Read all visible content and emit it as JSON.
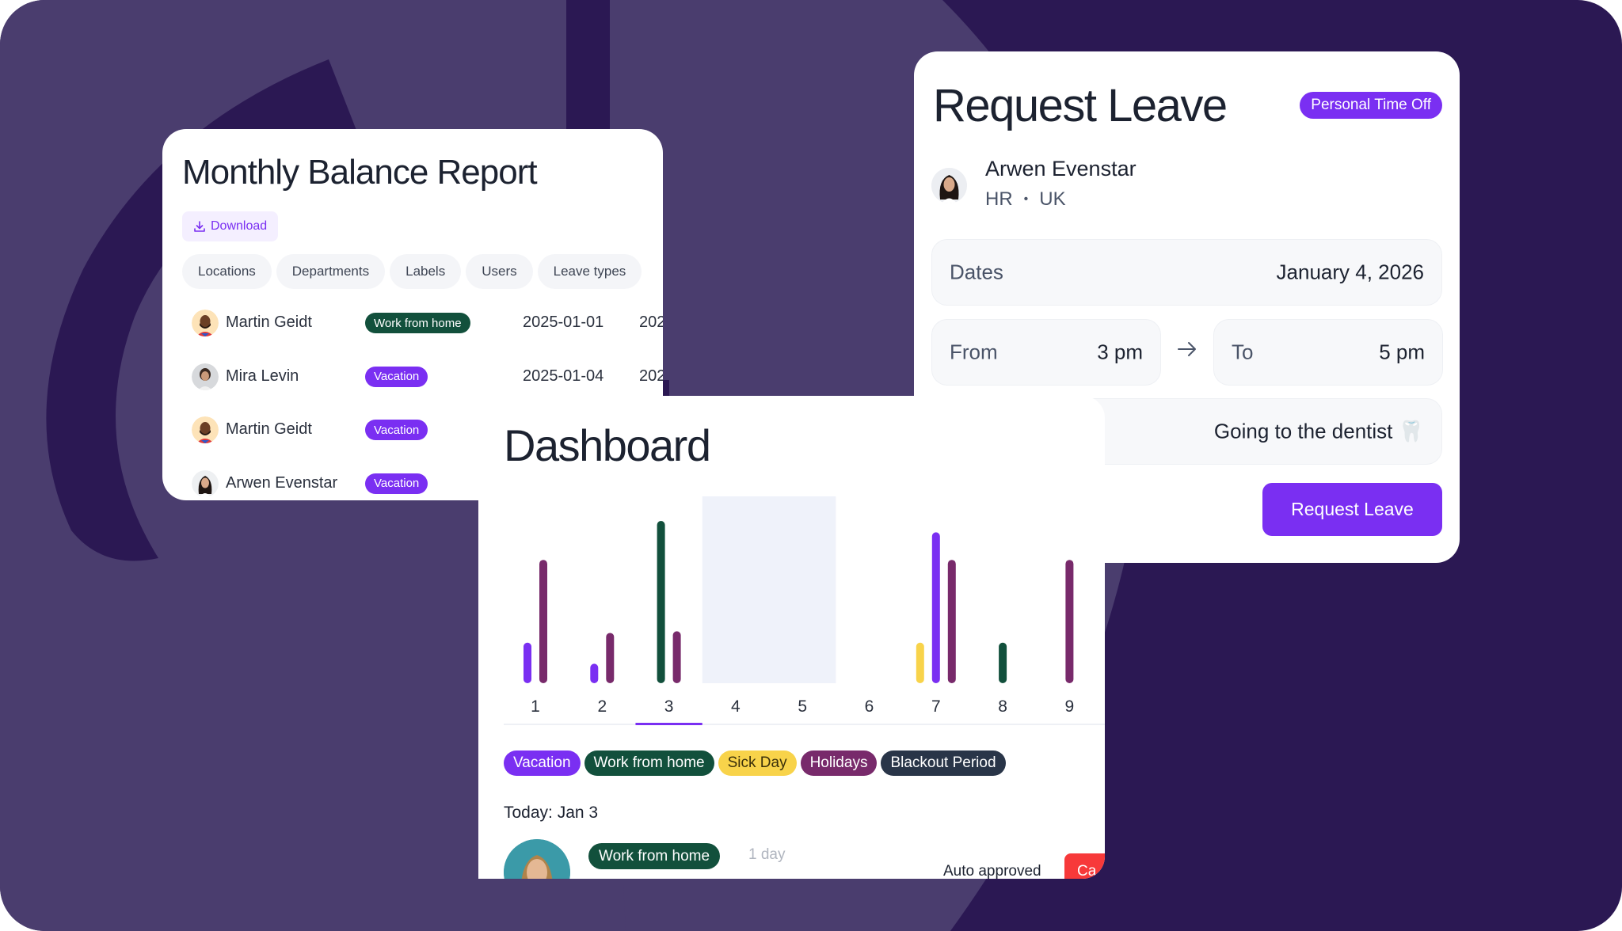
{
  "colors": {
    "bg_dark": "#2b1853",
    "bg_light": "#4a3d6e",
    "accent": "#7a2ff2",
    "vacation": "#7a2ff2",
    "work_from_home": "#12503c",
    "sick_day": "#f8d34a",
    "holidays": "#782a6b",
    "blackout": "#293548",
    "danger": "#f7393a"
  },
  "monthly_report": {
    "title": "Monthly Balance Report",
    "download_label": "Download",
    "filters": [
      "Locations",
      "Departments",
      "Labels",
      "Users",
      "Leave types"
    ],
    "rows": [
      {
        "name": "Martin Geidt",
        "leave_type": "Work from home",
        "type_key": "work_from_home",
        "start": "2025-01-01",
        "end": "202"
      },
      {
        "name": "Mira Levin",
        "leave_type": "Vacation",
        "type_key": "vacation",
        "start": "2025-01-04",
        "end": "202"
      },
      {
        "name": "Martin Geidt",
        "leave_type": "Vacation",
        "type_key": "vacation",
        "start": "",
        "end": ""
      },
      {
        "name": "Arwen Evenstar",
        "leave_type": "Vacation",
        "type_key": "vacation",
        "start": "",
        "end": ""
      }
    ]
  },
  "request_leave": {
    "title": "Request Leave",
    "badge": "Personal Time Off",
    "user": {
      "name": "Arwen Evenstar",
      "department": "HR",
      "separator": "•",
      "location": "UK"
    },
    "dates_label": "Dates",
    "dates_value": "January 4, 2026",
    "from_label": "From",
    "from_value": "3 pm",
    "to_label": "To",
    "to_value": "5 pm",
    "note_value": "Going to the dentist 🦷",
    "submit_label": "Request Leave"
  },
  "dashboard": {
    "title": "Dashboard",
    "legend": [
      {
        "label": "Vacation",
        "key": "vacation"
      },
      {
        "label": "Work from home",
        "key": "work_from_home"
      },
      {
        "label": "Sick Day",
        "key": "sick_day"
      },
      {
        "label": "Holidays",
        "key": "holidays"
      },
      {
        "label": "Blackout Period",
        "key": "blackout"
      }
    ],
    "today_label": "Today: Jan 3",
    "today_entry": {
      "leave_type": "Work from home",
      "duration": "1 day",
      "status": "Auto approved",
      "action_label": "Ca"
    }
  },
  "chart_data": {
    "type": "bar",
    "title": "",
    "xlabel": "",
    "ylabel": "",
    "categories": [
      "1",
      "2",
      "3",
      "4",
      "5",
      "6",
      "7",
      "8",
      "9"
    ],
    "selected_category": "3",
    "blackout_categories": [
      "4",
      "5"
    ],
    "ylim": [
      0,
      10
    ],
    "grid": false,
    "series": [
      {
        "name": "Sick Day",
        "key": "sick_day",
        "values": [
          0,
          0,
          0,
          0,
          0,
          0,
          2.5,
          0,
          0
        ]
      },
      {
        "name": "Vacation",
        "key": "vacation",
        "values": [
          2.5,
          1.2,
          0,
          0,
          0,
          0,
          9.3,
          0,
          0
        ]
      },
      {
        "name": "Work from home",
        "key": "work_from_home",
        "values": [
          0,
          0,
          10,
          0,
          0,
          0,
          0,
          2.5,
          0
        ]
      },
      {
        "name": "Holidays",
        "key": "holidays",
        "values": [
          7.6,
          3.1,
          3.2,
          0,
          0,
          0,
          7.6,
          0,
          7.6
        ]
      }
    ]
  }
}
